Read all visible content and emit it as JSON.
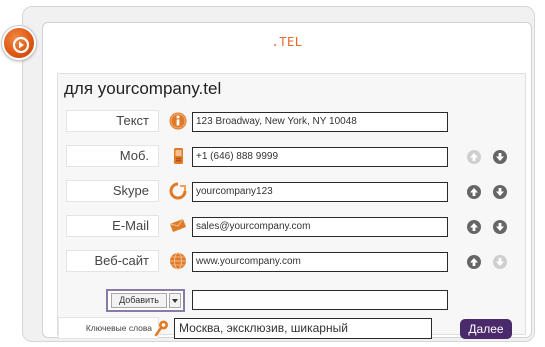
{
  "app": {
    "title": ".TEL"
  },
  "form": {
    "title": "для yourcompany.tel",
    "rows": [
      {
        "label": "Текст",
        "value": "123 Broadway, New York, NY 10048",
        "icon": "info-icon"
      },
      {
        "label": "Моб.",
        "value": "+1 (646) 888 9999",
        "icon": "mobile-phone-icon",
        "up_enabled": false,
        "down_enabled": true
      },
      {
        "label": "Skype",
        "value": "yourcompany123",
        "icon": "skype-icon",
        "up_enabled": true,
        "down_enabled": true
      },
      {
        "label": "E-Mail",
        "value": "sales@yourcompany.com",
        "icon": "envelope-icon",
        "up_enabled": true,
        "down_enabled": true
      },
      {
        "label": "Веб-сайт",
        "value": "www.yourcompany.com",
        "icon": "globe-icon",
        "up_enabled": true,
        "down_enabled": false
      }
    ],
    "add_button": {
      "label": "Добавить",
      "value": ""
    },
    "keywords": {
      "label": "Ключевые слова",
      "value": "Москва, эксклюзив, шикарный",
      "icon": "pin-icon"
    },
    "next_button": "Далее"
  },
  "colors": {
    "accent": "#e05a14",
    "primary_button": "#4a2a6a",
    "title_text": "#e2682a",
    "add_highlight": "#8a7aa8"
  }
}
